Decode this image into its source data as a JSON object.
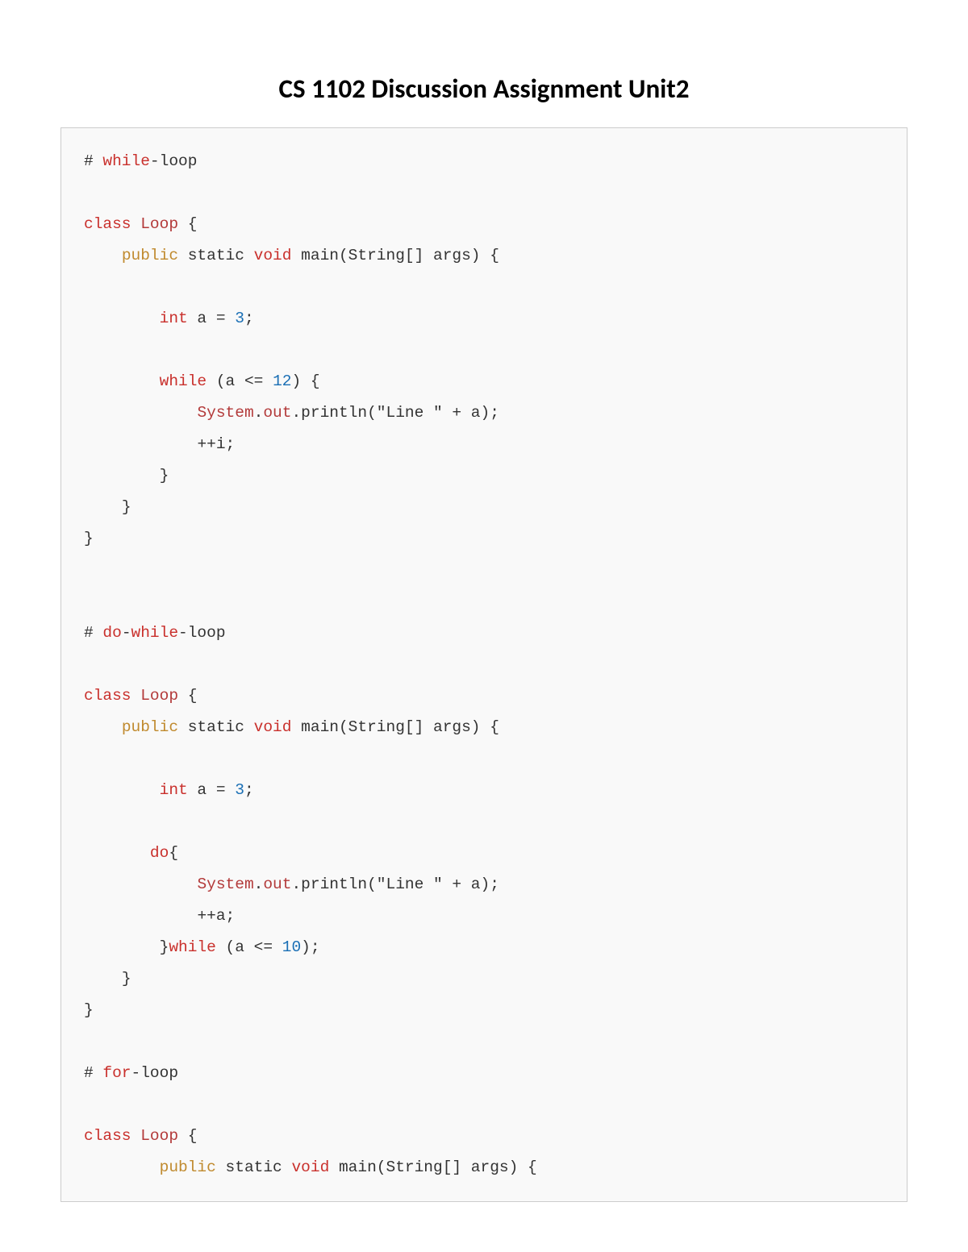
{
  "title": "CS 1102 Discussion Assignment Unit2",
  "code": {
    "while_comment_hash": "# ",
    "while_comment_red": "while",
    "while_comment_rest": "-loop",
    "dowhile_comment_hash": "# ",
    "dowhile_comment_red1": "do",
    "dowhile_comment_dash1": "-",
    "dowhile_comment_red2": "while",
    "dowhile_comment_rest": "-loop",
    "for_comment_hash": "# ",
    "for_comment_red": "for",
    "for_comment_rest": "-loop",
    "kw_class": "class",
    "id_loop": "Loop",
    "brace_open": " {",
    "kw_public": "public",
    "kw_static": " static ",
    "kw_void": "void",
    "main_sig": " main(String[] args) {",
    "kw_int": "int",
    "a_eq": " a = ",
    "num_3": "3",
    "semicolon": ";",
    "kw_while": "while",
    "while_cond_open": " (a <= ",
    "num_12": "12",
    "cond_close": ") {",
    "id_system": "System",
    "dot": ".",
    "id_out": "out",
    "println_call": ".println(\"Line \" + a);",
    "inc_i": "++i;",
    "inc_a": "++a;",
    "brace_close": "}",
    "kw_do": "do",
    "do_open": "{",
    "do_tail_close": "}",
    "dowhile_cond_open": " (a <= ",
    "num_10": "10",
    "dowhile_cond_close": ");"
  }
}
